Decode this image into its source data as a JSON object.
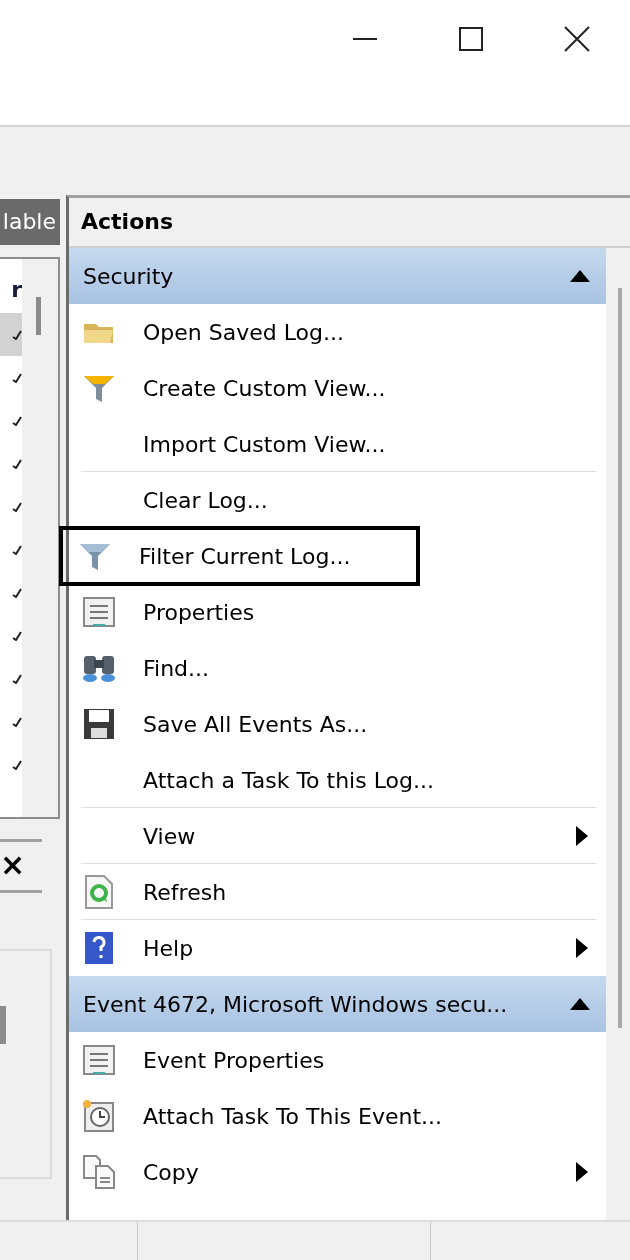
{
  "window": {
    "controls": [
      {
        "kind": "minimize"
      },
      {
        "kind": "maximize"
      },
      {
        "kind": "close"
      }
    ]
  },
  "left_pane": {
    "tab_label": "lable",
    "column_header": "r",
    "rows": [
      {
        "selected": true
      },
      {
        "selected": false
      },
      {
        "selected": false
      },
      {
        "selected": false
      },
      {
        "selected": false
      },
      {
        "selected": false
      },
      {
        "selected": false
      },
      {
        "selected": false
      },
      {
        "selected": false
      },
      {
        "selected": false
      },
      {
        "selected": false
      }
    ],
    "close_glyph": "×"
  },
  "actions": {
    "title": "Actions",
    "sections": [
      {
        "title": "Security",
        "expanded": true,
        "items": [
          {
            "label": "Open Saved Log...",
            "kind": "folder",
            "submenu": false,
            "divider_after": false,
            "highlighted": false
          },
          {
            "label": "Create Custom View...",
            "kind": "funnelgold",
            "submenu": false,
            "divider_after": false,
            "highlighted": false
          },
          {
            "label": "Import Custom View...",
            "kind": "plain",
            "submenu": false,
            "divider_after": true,
            "highlighted": false
          },
          {
            "label": "Clear Log...",
            "kind": "plain",
            "submenu": false,
            "divider_after": false,
            "highlighted": false
          },
          {
            "label": "Filter Current Log...",
            "kind": "funnel",
            "submenu": false,
            "divider_after": false,
            "highlighted": true
          },
          {
            "label": "Properties",
            "kind": "properties",
            "submenu": false,
            "divider_after": false,
            "highlighted": false
          },
          {
            "label": "Find...",
            "kind": "binoculars",
            "submenu": false,
            "divider_after": false,
            "highlighted": false
          },
          {
            "label": "Save All Events As...",
            "kind": "disk",
            "submenu": false,
            "divider_after": false,
            "highlighted": false
          },
          {
            "label": "Attach a Task To this Log...",
            "kind": "plain",
            "submenu": false,
            "divider_after": true,
            "highlighted": false
          },
          {
            "label": "View",
            "kind": "plain",
            "submenu": true,
            "divider_after": true,
            "highlighted": false
          },
          {
            "label": "Refresh",
            "kind": "refresh",
            "submenu": false,
            "divider_after": true,
            "highlighted": false
          },
          {
            "label": "Help",
            "kind": "help",
            "submenu": true,
            "divider_after": false,
            "highlighted": false
          }
        ]
      },
      {
        "title": "Event 4672, Microsoft Windows secu...",
        "expanded": true,
        "items": [
          {
            "label": "Event Properties",
            "kind": "properties",
            "submenu": false,
            "divider_after": false,
            "highlighted": false
          },
          {
            "label": "Attach Task To This Event...",
            "kind": "clock",
            "submenu": false,
            "divider_after": false,
            "highlighted": false
          },
          {
            "label": "Copy",
            "kind": "copy",
            "submenu": true,
            "divider_after": false,
            "highlighted": false
          }
        ]
      }
    ]
  }
}
